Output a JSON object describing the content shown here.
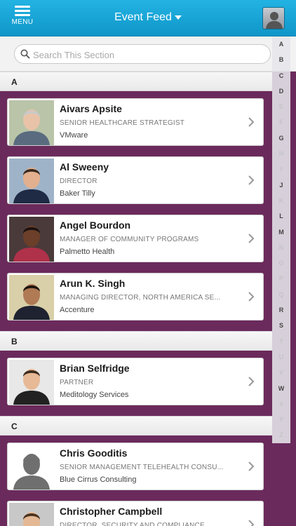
{
  "header": {
    "menu_label": "MENU",
    "title": "Event Feed"
  },
  "search": {
    "placeholder": "Search This Section"
  },
  "sections": [
    {
      "letter": "A",
      "people": [
        {
          "name": "Aivars Apsite",
          "title": "SENIOR HEALTHCARE STRATEGIST",
          "company": "VMware"
        },
        {
          "name": "Al Sweeny",
          "title": "DIRECTOR",
          "company": "Baker Tilly"
        },
        {
          "name": "Angel Bourdon",
          "title": "MANAGER OF COMMUNITY PROGRAMS",
          "company": "Palmetto Health"
        },
        {
          "name": "Arun K. Singh",
          "title": "MANAGING DIRECTOR, NORTH AMERICA SE...",
          "company": "Accenture"
        }
      ]
    },
    {
      "letter": "B",
      "people": [
        {
          "name": "Brian Selfridge",
          "title": "PARTNER",
          "company": "Meditology Services"
        }
      ]
    },
    {
      "letter": "C",
      "people": [
        {
          "name": "Chris Gooditis",
          "title": "SENIOR MANAGEMENT TELEHEALTH CONSU...",
          "company": "Blue Cirrus Consulting"
        },
        {
          "name": "Christopher Campbell",
          "title": "DIRECTOR, SECURITY AND COMPLIANCE",
          "company": ""
        }
      ]
    }
  ],
  "alphabet_index": [
    {
      "letter": "A",
      "active": true
    },
    {
      "letter": "B",
      "active": true
    },
    {
      "letter": "C",
      "active": true
    },
    {
      "letter": "D",
      "active": true
    },
    {
      "letter": "E",
      "active": false
    },
    {
      "letter": "F",
      "active": false
    },
    {
      "letter": "G",
      "active": true
    },
    {
      "letter": "H",
      "active": false
    },
    {
      "letter": "I",
      "active": false
    },
    {
      "letter": "J",
      "active": true
    },
    {
      "letter": "K",
      "active": false
    },
    {
      "letter": "L",
      "active": true
    },
    {
      "letter": "M",
      "active": true
    },
    {
      "letter": "N",
      "active": false
    },
    {
      "letter": "O",
      "active": false
    },
    {
      "letter": "P",
      "active": false
    },
    {
      "letter": "Q",
      "active": false
    },
    {
      "letter": "R",
      "active": true
    },
    {
      "letter": "S",
      "active": true
    },
    {
      "letter": "T",
      "active": false
    },
    {
      "letter": "U",
      "active": false
    },
    {
      "letter": "V",
      "active": false
    },
    {
      "letter": "W",
      "active": true
    },
    {
      "letter": "X",
      "active": false
    },
    {
      "letter": "Y",
      "active": false
    },
    {
      "letter": "Z",
      "active": false
    }
  ],
  "colors": {
    "header_blue": "#0f96c9",
    "list_background": "#6b2a5c"
  }
}
